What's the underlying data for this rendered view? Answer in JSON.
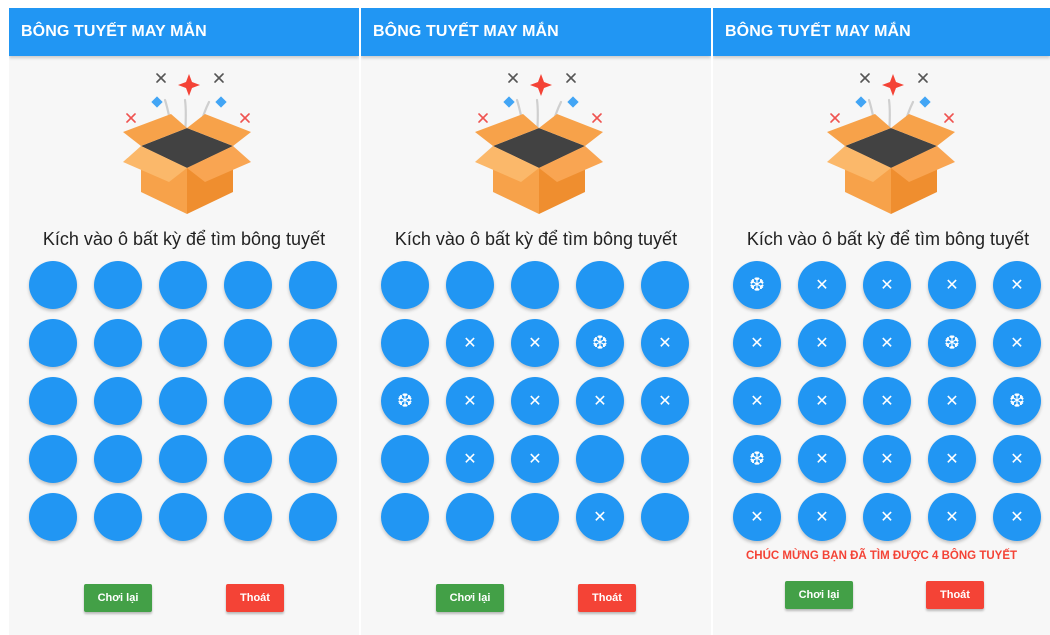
{
  "screens": [
    {
      "title": "BÔNG TUYẾT MAY MẮN",
      "instruction": "Kích vào ô bất kỳ để tìm bông tuyết",
      "grid": [
        [
          "",
          "",
          "",
          "",
          ""
        ],
        [
          "",
          "",
          "",
          "",
          ""
        ],
        [
          "",
          "",
          "",
          "",
          ""
        ],
        [
          "",
          "",
          "",
          "",
          ""
        ],
        [
          "",
          "",
          "",
          "",
          ""
        ]
      ],
      "replay_label": "Chơi lại",
      "exit_label": "Thoát",
      "message": ""
    },
    {
      "title": "BÔNG TUYẾT MAY MẮN",
      "instruction": "Kích vào ô bất kỳ để tìm bông tuyết",
      "grid": [
        [
          "",
          "",
          "",
          "",
          ""
        ],
        [
          "",
          "x",
          "x",
          "flake",
          "x"
        ],
        [
          "flake",
          "x",
          "x",
          "x",
          "x"
        ],
        [
          "",
          "x",
          "x",
          "",
          ""
        ],
        [
          "",
          "",
          "",
          "x",
          ""
        ]
      ],
      "replay_label": "Chơi lại",
      "exit_label": "Thoát",
      "message": ""
    },
    {
      "title": "BÔNG TUYẾT MAY MẮN",
      "instruction": "Kích vào ô bất kỳ để tìm bông tuyết",
      "grid": [
        [
          "flake",
          "x",
          "x",
          "x",
          "x"
        ],
        [
          "x",
          "x",
          "x",
          "flake",
          "x"
        ],
        [
          "x",
          "x",
          "x",
          "x",
          "flake"
        ],
        [
          "flake",
          "x",
          "x",
          "x",
          "x"
        ],
        [
          "x",
          "x",
          "x",
          "x",
          "x"
        ]
      ],
      "replay_label": "Chơi lại",
      "exit_label": "Thoát",
      "message": "CHÚC MỪNG BẠN ĐÃ TÌM ĐƯỢC 4 BÔNG TUYẾT"
    }
  ],
  "icons": {
    "x": "close-icon",
    "flake": "snowflake-icon"
  },
  "colors": {
    "primary": "#2196f3",
    "replay": "#43a047",
    "exit": "#f44336",
    "message": "#f44336"
  }
}
